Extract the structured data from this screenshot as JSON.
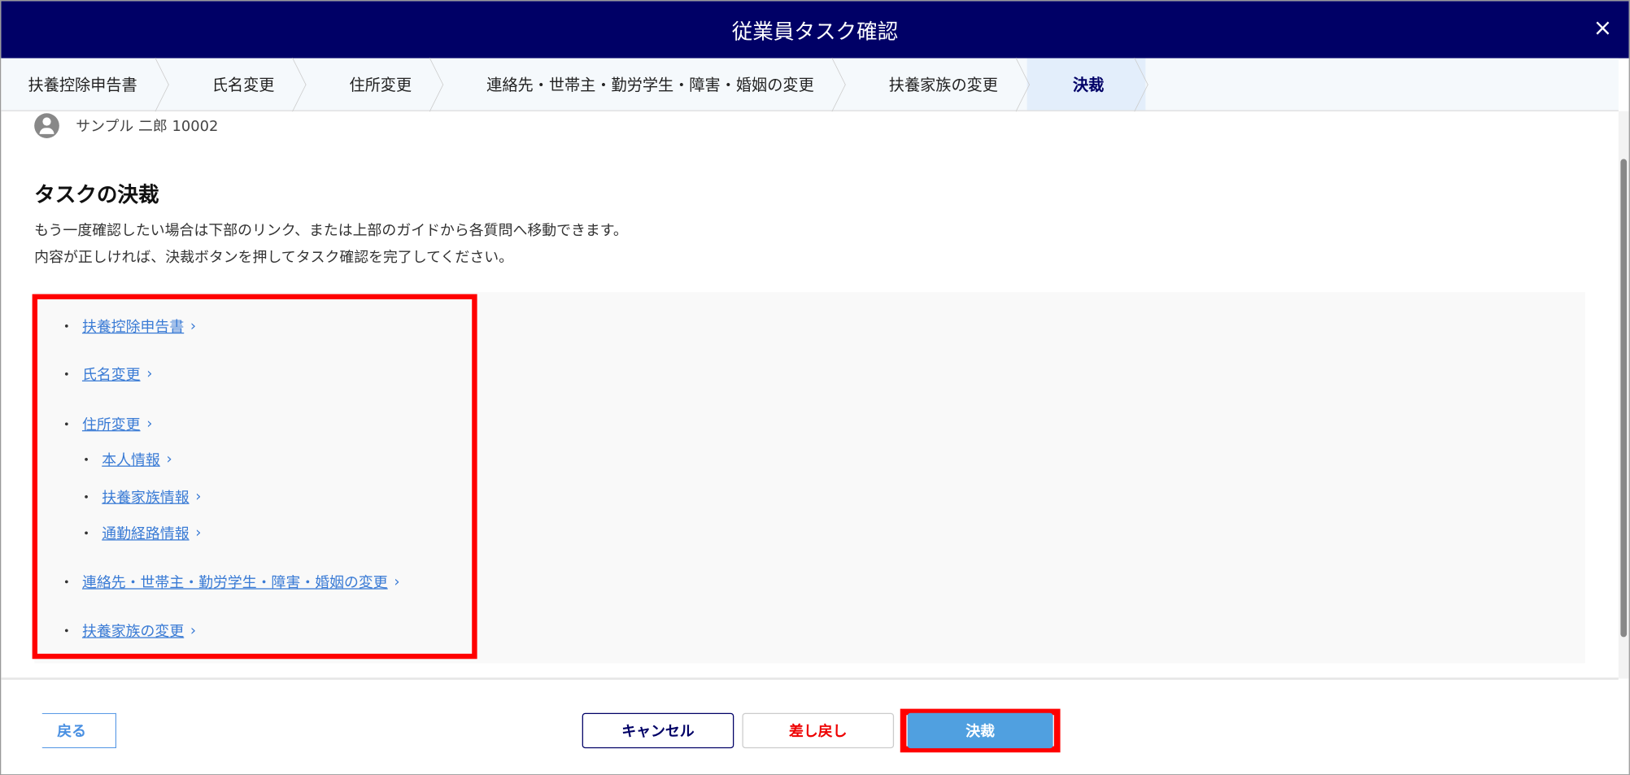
{
  "header": {
    "title": "従業員タスク確認",
    "close": "×"
  },
  "steps": [
    "扶養控除申告書",
    "氏名変更",
    "住所変更",
    "連絡先・世帯主・勤労学生・障害・婚姻の変更",
    "扶養家族の変更",
    "決裁"
  ],
  "user": {
    "name": "サンプル 二郎 10002"
  },
  "main": {
    "title": "タスクの決裁",
    "desc1": "もう一度確認したい場合は下部のリンク、または上部のガイドから各質問へ移動できます。",
    "desc2": "内容が正しければ、決裁ボタンを押してタスク確認を完了してください。"
  },
  "links": {
    "bullet": "・",
    "chevron": "›",
    "items": [
      "扶養控除申告書",
      "氏名変更",
      "住所変更",
      "本人情報",
      "扶養家族情報",
      "通勤経路情報",
      "連絡先・世帯主・勤労学生・障害・婚姻の変更",
      "扶養家族の変更"
    ]
  },
  "footer": {
    "back": "戻る",
    "cancel": "キャンセル",
    "reject": "差し戻し",
    "approve": "決裁"
  }
}
